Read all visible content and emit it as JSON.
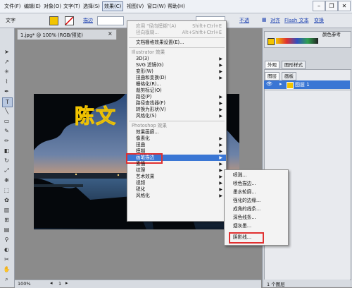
{
  "menubar": {
    "items": [
      "文件(F)",
      "编辑(E)",
      "对象(O)",
      "文字(T)",
      "选择(S)",
      "效果(C)",
      "视图(V)",
      "窗口(W)",
      "帮助(H)"
    ],
    "active_index": 5,
    "window_controls": [
      "minimize-icon",
      "restore-icon",
      "close-icon"
    ]
  },
  "ctrlbar": {
    "mode_label": "文字",
    "stroke_label": "描边",
    "opacity_label": "不透",
    "align_label": "对齐",
    "flash_label": "Flash 文本",
    "transform_label": "变换",
    "colors": {
      "fill": "#f2c400",
      "stroke": "#ffffff"
    }
  },
  "document": {
    "tab_title": "1.jpg* @ 100% (RGB/预览)",
    "zoom": "100%",
    "artboard": "1"
  },
  "effect_menu": {
    "items": [
      {
        "label": "应用 \"径向模糊\"(A)",
        "shortcut": "Shift+Ctrl+E",
        "disabled": true
      },
      {
        "label": "径向模糊...",
        "shortcut": "Alt+Shift+Ctrl+E",
        "disabled": true
      },
      {
        "sep": true
      },
      {
        "label": "文档栅格效果设置(E)..."
      },
      {
        "sep": true
      },
      {
        "label": "Illustrator 效果",
        "header": true
      },
      {
        "label": "3D(3)",
        "arrow": true
      },
      {
        "label": "SVG 滤镜(G)",
        "arrow": true
      },
      {
        "label": "变形(W)",
        "arrow": true
      },
      {
        "label": "扭曲和变换(D)",
        "arrow": true
      },
      {
        "label": "栅格化(R)..."
      },
      {
        "label": "裁剪标记(O)"
      },
      {
        "label": "路径(P)",
        "arrow": true
      },
      {
        "label": "路径查找器(F)",
        "arrow": true
      },
      {
        "label": "转换为形状(V)",
        "arrow": true
      },
      {
        "label": "风格化(S)",
        "arrow": true
      },
      {
        "sep": true
      },
      {
        "label": "Photoshop 效果",
        "header": true
      },
      {
        "label": "效果画廊..."
      },
      {
        "label": "像素化",
        "arrow": true
      },
      {
        "label": "扭曲",
        "arrow": true
      },
      {
        "label": "模糊",
        "arrow": true
      },
      {
        "label": "画笔描边",
        "arrow": true,
        "highlighted": true
      },
      {
        "label": "素描",
        "arrow": true
      },
      {
        "label": "纹理",
        "arrow": true
      },
      {
        "label": "艺术效果",
        "arrow": true
      },
      {
        "label": "视频",
        "arrow": true
      },
      {
        "label": "锐化",
        "arrow": true
      },
      {
        "label": "风格化",
        "arrow": true
      }
    ]
  },
  "brush_submenu": {
    "items": [
      "喷溅...",
      "喷色描边...",
      "墨水轮廓...",
      "强化的边缘...",
      "成角的线条...",
      "深色线条...",
      "烟灰墨...",
      "阴影线..."
    ],
    "boxed_index": 7
  },
  "panels": {
    "tabs_top": [
      "外观",
      "图形样式"
    ],
    "tabs_layers": [
      "图层",
      "画板"
    ],
    "layer_name": "图层 1",
    "layer_count": "1 个图层",
    "color_tab": "颜色参考"
  },
  "photo_text": "陈文"
}
